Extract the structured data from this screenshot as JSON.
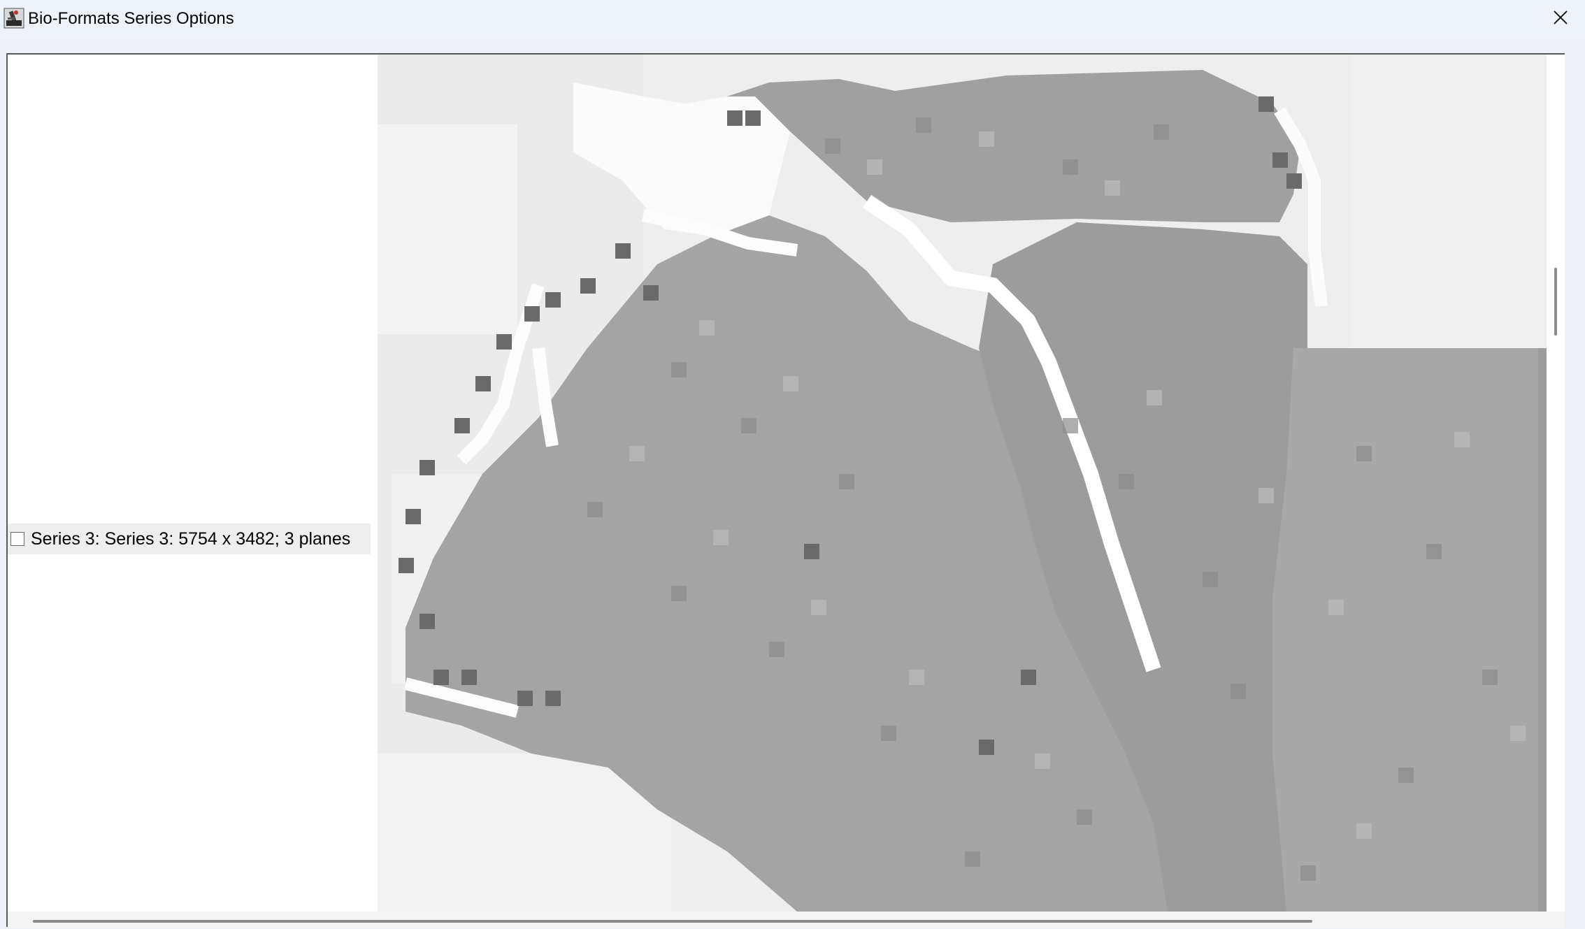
{
  "window": {
    "title": "Bio-Formats Series Options",
    "icon": "imagej-microscope-icon",
    "close_icon": "close-icon"
  },
  "series_list": {
    "items": [
      {
        "label": "Series 3: Series 3: 5754 x 3482; 3 planes",
        "checked": false
      }
    ]
  },
  "thumbnail": {
    "description_icon": "grayscale-tissue-thumbnail",
    "colors": {
      "background": "#efefef",
      "tissue": "#9a9a9a",
      "dark": "#6a6a6a",
      "white_gap": "#ffffff"
    }
  }
}
